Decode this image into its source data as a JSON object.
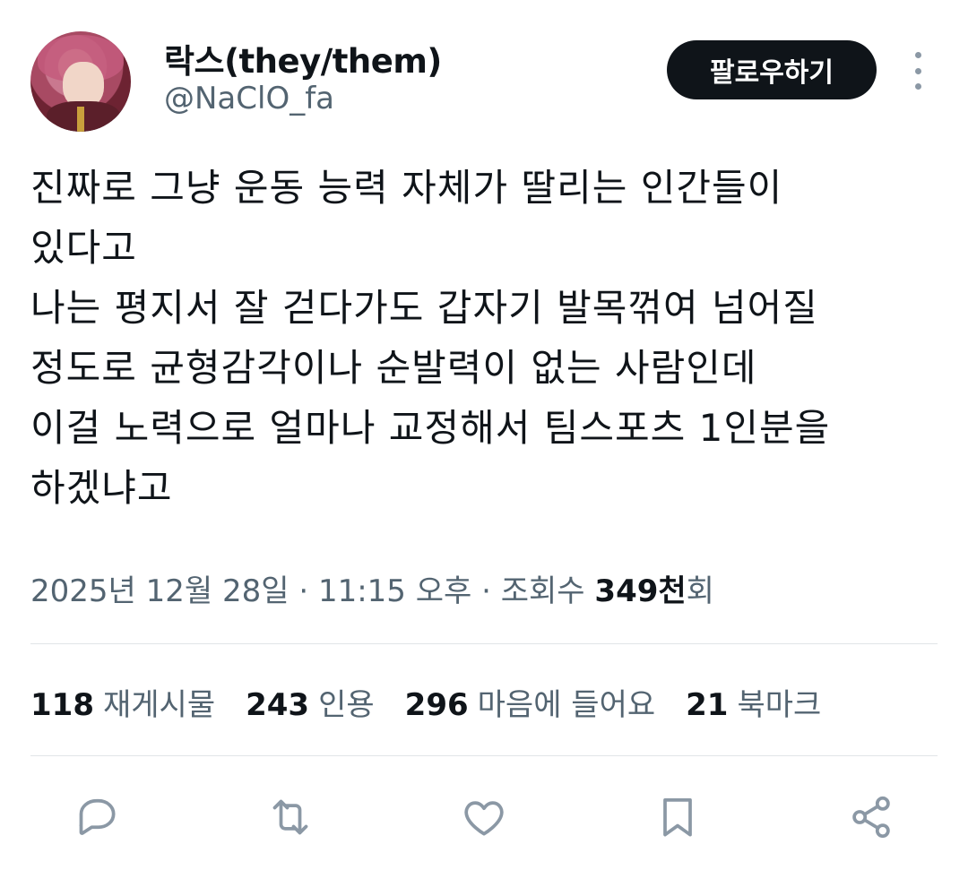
{
  "user": {
    "display_name": "락스(they/them)",
    "handle": "@NaClO_fa"
  },
  "header": {
    "follow_label": "팔로우하기"
  },
  "tweet": {
    "text": "진짜로 그냥 운동 능력 자체가 딸리는 인간들이\n있다고\n나는 평지서 잘 걷다가도 갑자기 발목꺾여 넘어질\n정도로 균형감각이나 순발력이 없는 사람인데\n이걸 노력으로 얼마나 교정해서 팀스포츠 1인분을\n하겠냐고"
  },
  "meta": {
    "date": "2025년 12월 28일",
    "separator": " · ",
    "time": "11:15 오후",
    "views_label": "조회수 ",
    "views_count": "349천",
    "views_suffix": "회"
  },
  "stats": {
    "retweets": {
      "count": "118",
      "label": "재게시물"
    },
    "quotes": {
      "count": "243",
      "label": "인용"
    },
    "likes": {
      "count": "296",
      "label": "마음에 들어요"
    },
    "bookmarks": {
      "count": "21",
      "label": "북마크"
    }
  },
  "actions": [
    "reply-icon",
    "retweet-icon",
    "like-icon",
    "bookmark-icon",
    "share-icon"
  ],
  "colors": {
    "text_primary": "#0f1419",
    "text_secondary": "#536471",
    "button_bg": "#0f1419",
    "icon": "#8b98a5",
    "divider": "#e1e5e8"
  }
}
